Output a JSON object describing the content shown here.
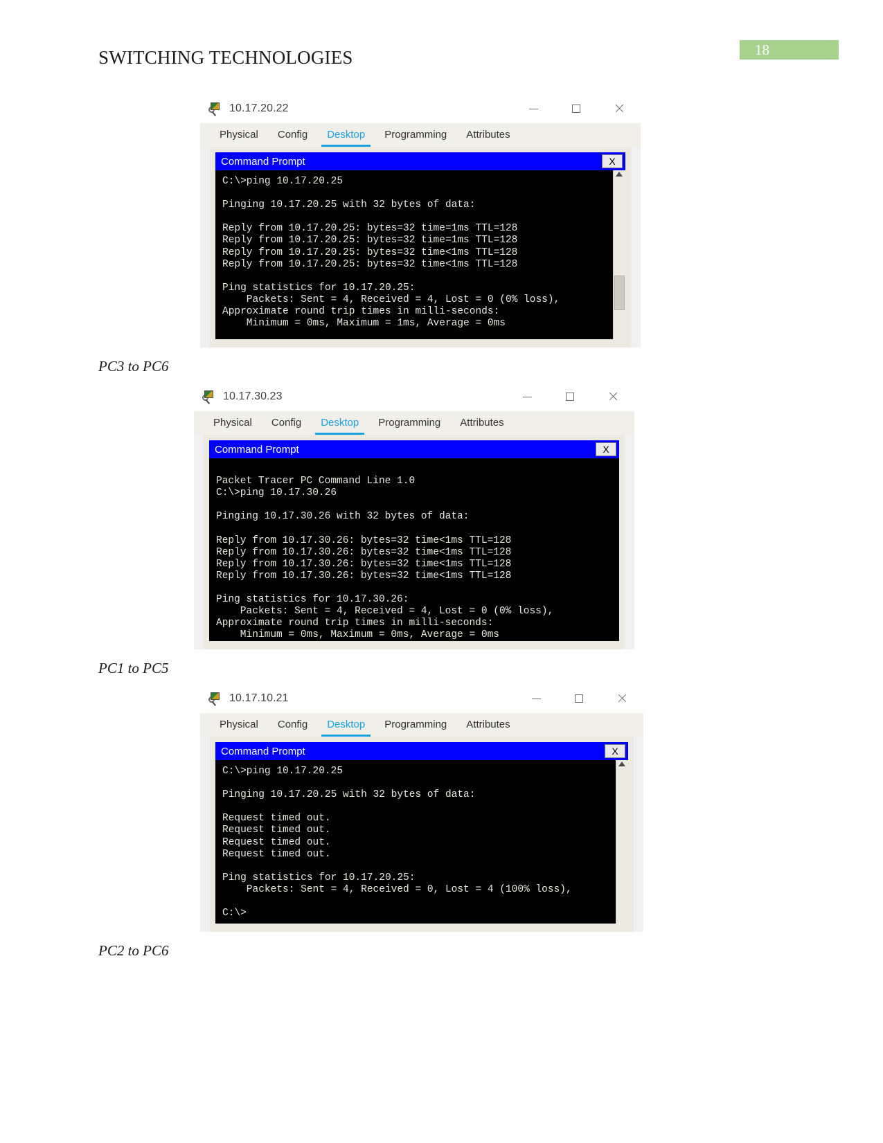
{
  "document": {
    "title": "SWITCHING TECHNOLOGIES",
    "page_number": "18",
    "page_number_bg": "#a9d18e"
  },
  "captions": [
    {
      "text": "PC3 to PC6"
    },
    {
      "text": "PC1 to PC5"
    },
    {
      "text": "PC2 to PC6"
    }
  ],
  "windows": [
    {
      "title": "10.17.20.22",
      "icon": "packet-tracer-icon",
      "controls": {
        "minimize": "minimize-icon",
        "maximize": "maximize-icon",
        "close": "close-icon"
      },
      "tabs": [
        {
          "label": "Physical",
          "active": false
        },
        {
          "label": "Config",
          "active": false
        },
        {
          "label": "Desktop",
          "active": true
        },
        {
          "label": "Programming",
          "active": false
        },
        {
          "label": "Attributes",
          "active": false
        }
      ],
      "command_prompt": {
        "title": "Command Prompt",
        "close_label": "X",
        "output": "C:\\>ping 10.17.20.25\n\nPinging 10.17.20.25 with 32 bytes of data:\n\nReply from 10.17.20.25: bytes=32 time=1ms TTL=128\nReply from 10.17.20.25: bytes=32 time=1ms TTL=128\nReply from 10.17.20.25: bytes=32 time<1ms TTL=128\nReply from 10.17.20.25: bytes=32 time<1ms TTL=128\n\nPing statistics for 10.17.20.25:\n    Packets: Sent = 4, Received = 4, Lost = 0 (0% loss),\nApproximate round trip times in milli-seconds:\n    Minimum = 0ms, Maximum = 1ms, Average = 0ms"
      }
    },
    {
      "title": "10.17.30.23",
      "icon": "packet-tracer-icon",
      "controls": {
        "minimize": "minimize-icon",
        "maximize": "maximize-icon",
        "close": "close-icon"
      },
      "tabs": [
        {
          "label": "Physical",
          "active": false
        },
        {
          "label": "Config",
          "active": false
        },
        {
          "label": "Desktop",
          "active": true
        },
        {
          "label": "Programming",
          "active": false
        },
        {
          "label": "Attributes",
          "active": false
        }
      ],
      "command_prompt": {
        "title": "Command Prompt",
        "close_label": "X",
        "output": "\nPacket Tracer PC Command Line 1.0\nC:\\>ping 10.17.30.26\n\nPinging 10.17.30.26 with 32 bytes of data:\n\nReply from 10.17.30.26: bytes=32 time<1ms TTL=128\nReply from 10.17.30.26: bytes=32 time<1ms TTL=128\nReply from 10.17.30.26: bytes=32 time<1ms TTL=128\nReply from 10.17.30.26: bytes=32 time<1ms TTL=128\n\nPing statistics for 10.17.30.26:\n    Packets: Sent = 4, Received = 4, Lost = 0 (0% loss),\nApproximate round trip times in milli-seconds:\n    Minimum = 0ms, Maximum = 0ms, Average = 0ms"
      }
    },
    {
      "title": "10.17.10.21",
      "icon": "packet-tracer-icon",
      "controls": {
        "minimize": "minimize-icon",
        "maximize": "maximize-icon",
        "close": "close-icon"
      },
      "tabs": [
        {
          "label": "Physical",
          "active": false
        },
        {
          "label": "Config",
          "active": false
        },
        {
          "label": "Desktop",
          "active": true
        },
        {
          "label": "Programming",
          "active": false
        },
        {
          "label": "Attributes",
          "active": false
        }
      ],
      "command_prompt": {
        "title": "Command Prompt",
        "close_label": "X",
        "output": "C:\\>ping 10.17.20.25\n\nPinging 10.17.20.25 with 32 bytes of data:\n\nRequest timed out.\nRequest timed out.\nRequest timed out.\nRequest timed out.\n\nPing statistics for 10.17.20.25:\n    Packets: Sent = 4, Received = 0, Lost = 4 (100% loss),\n\nC:\\>"
      }
    }
  ]
}
